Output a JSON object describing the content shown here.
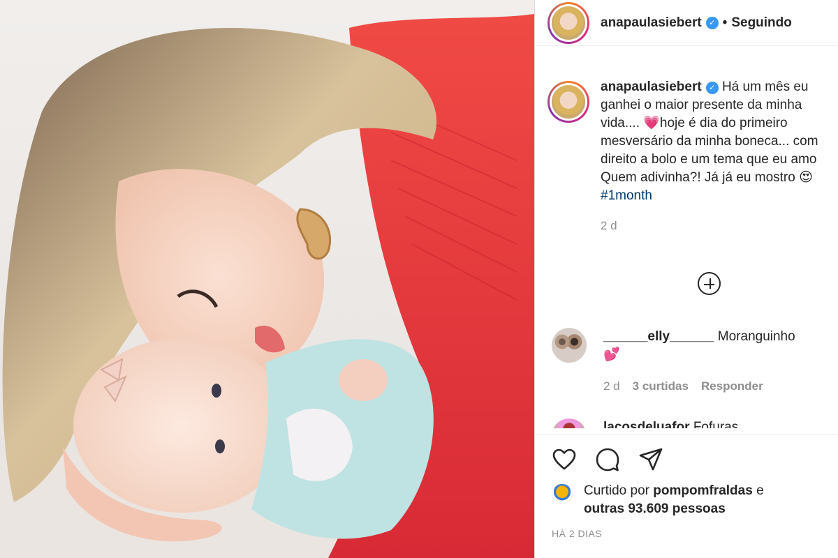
{
  "header": {
    "username": "anapaulasiebert",
    "separator": "•",
    "follow_status": "Seguindo"
  },
  "caption": {
    "username": "anapaulasiebert",
    "lines": [
      "Há um mês eu",
      "ganhei o maior presente da minha",
      "vida.... 💗hoje é dia do primeiro",
      "mesversário da minha boneca... com",
      "direito a bolo e um tema que eu amo",
      "Quem adivinha?! Já já eu mostro 😍"
    ],
    "hashtag": "#1month",
    "time": "2 d"
  },
  "comments": [
    {
      "username": "______elly______",
      "text": "Moranguinho",
      "emoji": "💕",
      "time": "2 d",
      "likes": "3 curtidas",
      "reply": "Responder"
    },
    {
      "username": "lacosdeluafor",
      "text": "Fofuras"
    }
  ],
  "actions": {
    "icons": [
      "heart-icon",
      "comment-icon",
      "share-icon"
    ]
  },
  "likes": {
    "prefix": "Curtido por",
    "user": "pompomfraldas",
    "conjunction": "e",
    "others": "outras 93.609 pessoas"
  },
  "posted": "HÁ 2 DIAS",
  "colors": {
    "verified": "#3897f0",
    "text": "#262626",
    "muted": "#8e8e8e",
    "hashtag": "#00376b",
    "dress": "#e8323a"
  }
}
